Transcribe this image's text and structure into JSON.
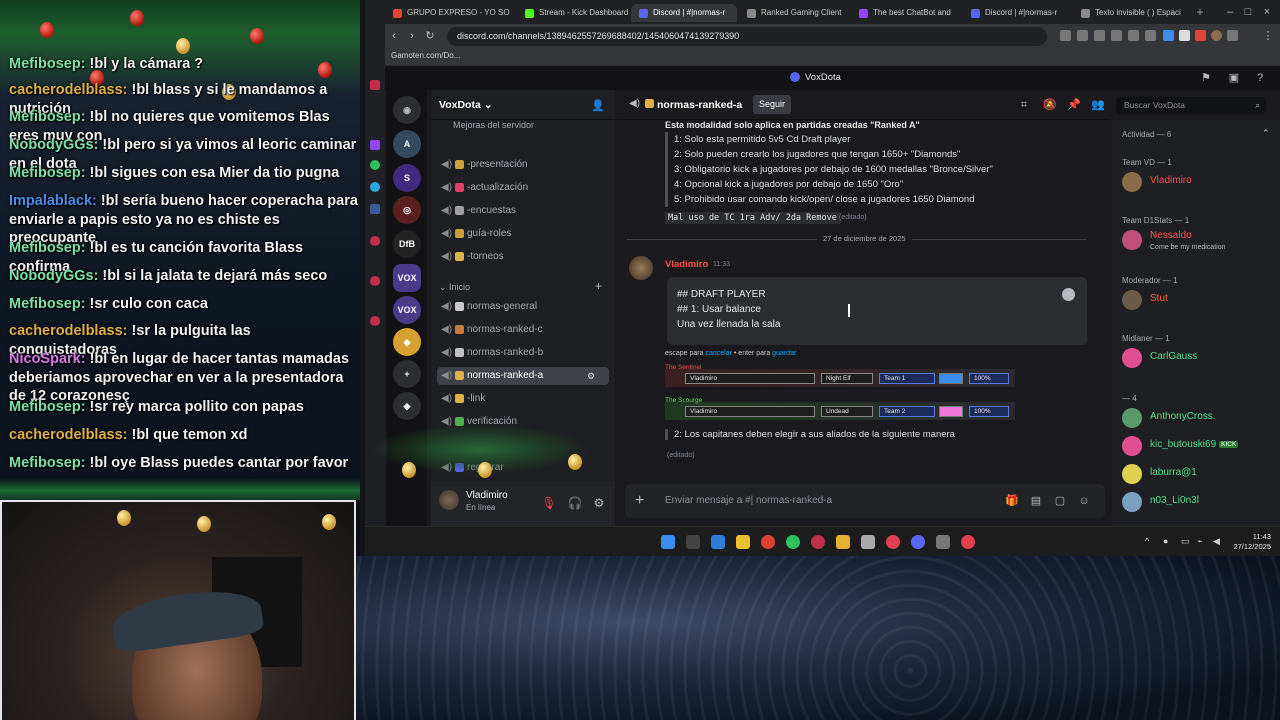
{
  "stream_chat": {
    "messages": [
      {
        "user": "Mefibosep:",
        "text": "!bl y la cámara ?",
        "color": "#7fe0a6"
      },
      {
        "user": "cacherodelblass:",
        "text": "!bl blass y si le mandamos a nutrición",
        "color": "#e0b048"
      },
      {
        "user": "Mefibosep:",
        "text": "!bl no quieres que vomitemos Blas eres muy con",
        "color": "#7fe0a6"
      },
      {
        "user": "NobodyGGs:",
        "text": "!bl pero si ya vimos al leoric caminar en el dota",
        "color": "#7fe0a6"
      },
      {
        "user": "Mefibosep:",
        "text": "!bl sigues con esa Mier da tio pugna",
        "color": "#7fe0a6"
      },
      {
        "user": "Impalablack:",
        "text": "!bl sería bueno hacer coperacha para enviarle a papis esto ya no es chiste es preocupante",
        "color": "#4f8be8"
      },
      {
        "user": "Mefibosep:",
        "text": "!bl es tu canción favorita Blass confirma",
        "color": "#7fe0a6"
      },
      {
        "user": "NobodyGGs:",
        "text": "!bl si la jalata te dejará más seco",
        "color": "#7fe0a6"
      },
      {
        "user": "Mefibosep:",
        "text": "!sr culo con caca",
        "color": "#7fe0a6"
      },
      {
        "user": "cacherodelblass:",
        "text": "!sr la pulguita las conquistadoras",
        "color": "#e0b048"
      },
      {
        "user": "NicoSpark:",
        "text": "!bl en lugar de hacer tantas mamadas deberiamos aprovechar en ver a la presentadora de 12 corazonesç",
        "color": "#d57be8"
      },
      {
        "user": "Mefibosep:",
        "text": "!sr rey marca pollito con papas",
        "color": "#7fe0a6"
      },
      {
        "user": "cacherodelblass:",
        "text": "!bl que temon xd",
        "color": "#e0b048"
      },
      {
        "user": "Mefibosep:",
        "text": "!bl oye Blass puedes cantar por favor",
        "color": "#7fe0a6"
      }
    ]
  },
  "browser": {
    "tabs": [
      {
        "label": "GRUPO EXPRESO - YO SO",
        "color": "#e0443a"
      },
      {
        "label": "Stream - Kick Dashboard",
        "color": "#53fc18"
      },
      {
        "label": "Discord | #|normas-r",
        "color": "#5865f2"
      },
      {
        "label": "Ranked Gaming Client",
        "color": "#8a8a8a"
      },
      {
        "label": "The best ChatBot and",
        "color": "#9146ff"
      },
      {
        "label": "Discord | #|normas-r",
        "color": "#5865f2"
      },
      {
        "label": "Texto invisible ( ) Espaci",
        "color": "#8a8a8a"
      }
    ],
    "url": "discord.com/channels/1389462557269688402/1454060474139279390",
    "bookmark": "Gamoten.com/Do..."
  },
  "discord": {
    "window_title": "VoxDota",
    "server_name": "VoxDota",
    "server_header_extra": "Mejoras del servidor",
    "servers": [
      "DfB"
    ],
    "channels_top": [
      {
        "label": "-presentación"
      },
      {
        "label": "-actualización"
      },
      {
        "label": "-encuestas"
      },
      {
        "label": "guía-roles"
      },
      {
        "label": "-torneos"
      }
    ],
    "category": "Inicio",
    "channels_bottom": [
      {
        "label": "normas-general",
        "active": false
      },
      {
        "label": "normas-ranked-c",
        "active": false
      },
      {
        "label": "normas-ranked-b",
        "active": false
      },
      {
        "label": "normas-ranked-a",
        "active": true
      },
      {
        "label": "-link",
        "active": false
      },
      {
        "label": "verificación",
        "active": false
      },
      {
        "label": "registrar",
        "active": false
      }
    ],
    "user": {
      "name": "Vladimiro",
      "status": "En línea"
    },
    "channel_header": {
      "title": "normas-ranked-a",
      "follow": "Seguir"
    },
    "search_placeholder": "Buscar VoxDota",
    "messages": {
      "pinned_heading": "Esta modalidad solo aplica en partidas creadas \"Ranked A\"",
      "rules": [
        "1: Solo esta permitido 5v5 Cd Draft player",
        "2: Solo pueden crearlo los jugadores que tengan 1650+ \"Diamonds\"",
        "3: Obligatorio kick a jugadores por debajo de 1600 medallas \"Bronce/Silver\"",
        "4: Opcional kick a jugadores por debajo de 1650 \"Oro\"",
        "5: Prohibido usar comando kick/open/ close a jugadores 1650 Diamond"
      ],
      "misuse_code": "Mal uso de TC 1ra Adv/ 2da Remove",
      "edited": "(editado)",
      "date_separator": "27 de diciembre de 2025",
      "author": "Vladimiro",
      "time": "11:33",
      "editing_lines": [
        "## DRAFT PLAYER",
        "## 1: Usar balance",
        "Una vez llenada la sala"
      ],
      "edit_hint_prefix": "escape para",
      "edit_hint_cancel": "cancelar",
      "edit_hint_mid": "• enter para",
      "edit_hint_save": "guardar",
      "panels": [
        {
          "label": "The Sentinel",
          "label_color": "#ff4d4d",
          "name": "Vladimiro",
          "race": "Night Elf",
          "team": "Team 1",
          "swatch": "#3b8ef0",
          "handicap": "100%"
        },
        {
          "label": "The Scourge",
          "label_color": "#6adf5a",
          "name": "Vladimiro",
          "race": "Undead",
          "team": "Team 2",
          "swatch": "#f07ad8",
          "handicap": "100%"
        }
      ],
      "rule2": "2: Los capitanes deben elegir a sus aliados de la siguiente manera",
      "rule2_edited": "(editado)"
    },
    "composer_placeholder": "Enviar mensaje a #| normas-ranked-a",
    "members": {
      "activity": "Actividad — 6",
      "groups": [
        {
          "name": "Team VD — 1",
          "members": [
            {
              "name": "Vladimiro",
              "sub": "",
              "color": "#ff4d4d",
              "avatar": "#8a6b4a"
            }
          ]
        },
        {
          "name": "Team D1Stats — 1",
          "members": [
            {
              "name": "Nessaldo",
              "sub": "Come be my medication",
              "color": "#ff4d4d",
              "avatar": "#c0507a"
            }
          ]
        },
        {
          "name": "Moderador — 1",
          "members": [
            {
              "name": "Stut",
              "sub": "",
              "color": "#ff5a3c",
              "avatar": "#6b5a4a"
            }
          ]
        },
        {
          "name": "Midlaner — 1",
          "members": [
            {
              "name": "CarlGauss",
              "sub": "",
              "color": "#4fe08a",
              "avatar": "#e05090"
            }
          ]
        },
        {
          "name": "— 4",
          "members": [
            {
              "name": "AnthonyCross.",
              "sub": "",
              "color": "#4fe08a",
              "avatar": "#5a9a6a"
            },
            {
              "name": "kic_butouski69",
              "sub": "",
              "color": "#4fe08a",
              "avatar": "#e05090",
              "badge": "KICK"
            },
            {
              "name": "laburra@1",
              "sub": "",
              "color": "#4fe08a",
              "avatar": "#e0d050"
            },
            {
              "name": "n03_Li0n3l",
              "sub": "",
              "color": "#4fe08a",
              "avatar": "#7aa0c0"
            }
          ]
        }
      ]
    }
  },
  "taskbar": {
    "time": "11:43",
    "date": "27/12/2025"
  }
}
